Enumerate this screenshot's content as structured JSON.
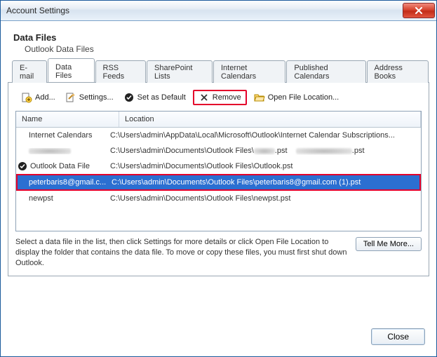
{
  "window": {
    "title": "Account Settings"
  },
  "header": {
    "heading": "Data Files",
    "subheading": "Outlook Data Files"
  },
  "tabs": [
    {
      "label": "E-mail"
    },
    {
      "label": "Data Files"
    },
    {
      "label": "RSS Feeds"
    },
    {
      "label": "SharePoint Lists"
    },
    {
      "label": "Internet Calendars"
    },
    {
      "label": "Published Calendars"
    },
    {
      "label": "Address Books"
    }
  ],
  "active_tab_index": 1,
  "toolbar": {
    "add": "Add...",
    "settings": "Settings...",
    "set_default": "Set as Default",
    "remove": "Remove",
    "open_location": "Open File Location..."
  },
  "columns": {
    "name": "Name",
    "location": "Location"
  },
  "rows": [
    {
      "name": "Internet Calendars",
      "location": "C:\\Users\\admin\\AppData\\Local\\Microsoft\\Outlook\\Internet Calendar Subscriptions...",
      "default": false,
      "selected": false,
      "redacted": false
    },
    {
      "name": "",
      "location": "C:\\Users\\admin\\Documents\\Outlook Files\\",
      "location_suffix": ".pst",
      "default": false,
      "selected": false,
      "redacted": true
    },
    {
      "name": "Outlook Data File",
      "location": "C:\\Users\\admin\\Documents\\Outlook Files\\Outlook.pst",
      "default": true,
      "selected": false,
      "redacted": false
    },
    {
      "name": "peterbaris8@gmail.c...",
      "location": "C:\\Users\\admin\\Documents\\Outlook Files\\peterbaris8@gmail.com (1).pst",
      "default": false,
      "selected": true,
      "redacted": false
    },
    {
      "name": "newpst",
      "location": "C:\\Users\\admin\\Documents\\Outlook Files\\newpst.pst",
      "default": false,
      "selected": false,
      "redacted": false
    }
  ],
  "help_text": "Select a data file in the list, then click Settings for more details or click Open File Location to display the folder that contains the data file. To move or copy these files, you must first shut down Outlook.",
  "tell_me_more": "Tell Me More...",
  "close_label": "Close"
}
